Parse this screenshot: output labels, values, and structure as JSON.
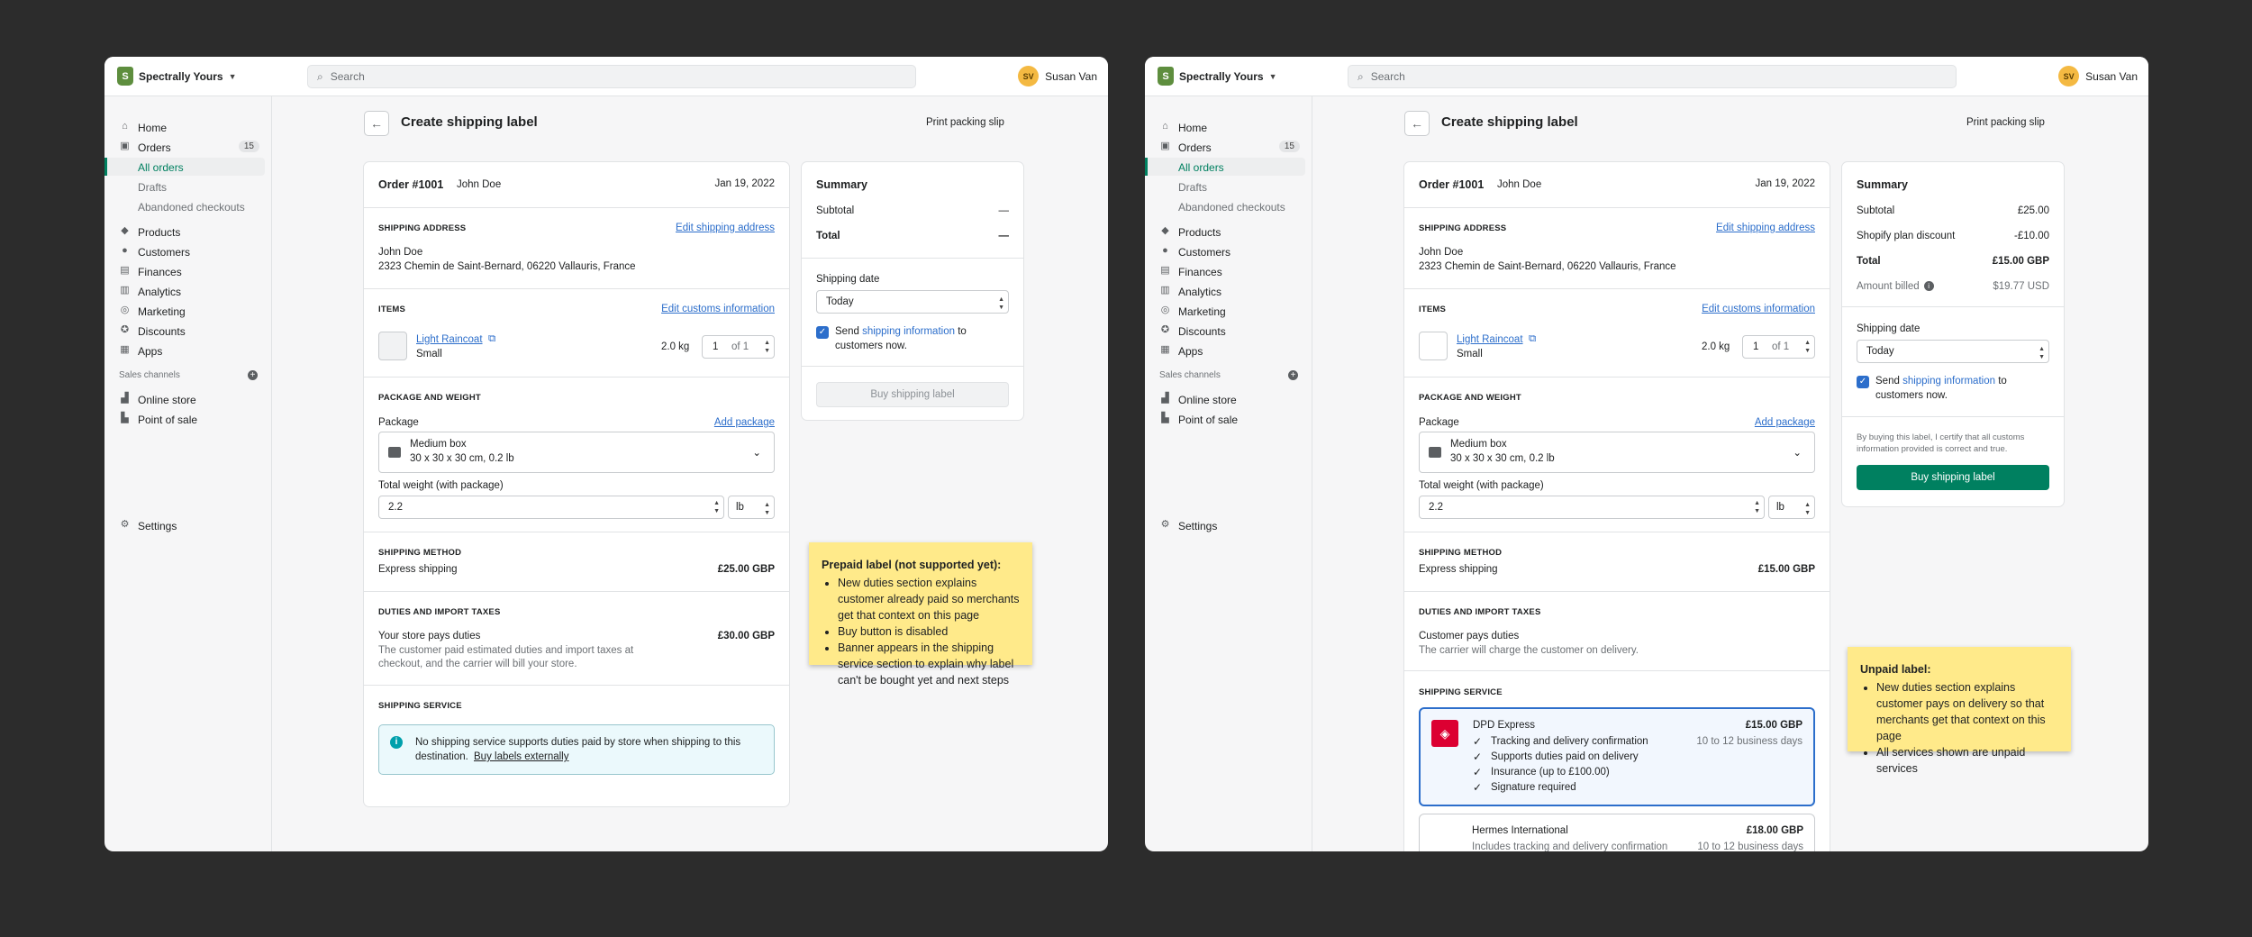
{
  "store_name": "Spectrally Yours",
  "search_placeholder": "Search",
  "user": {
    "initials": "SV",
    "name": "Susan Van"
  },
  "nav": {
    "home": "Home",
    "orders": "Orders",
    "orders_count": "15",
    "all_orders": "All orders",
    "drafts": "Drafts",
    "abandoned": "Abandoned checkouts",
    "products": "Products",
    "customers": "Customers",
    "finances": "Finances",
    "analytics": "Analytics",
    "marketing": "Marketing",
    "discounts": "Discounts",
    "apps": "Apps",
    "sales_channels": "Sales channels",
    "online_store": "Online store",
    "point_of_sale": "Point of sale",
    "settings": "Settings"
  },
  "page": {
    "title": "Create shipping label",
    "print_slip": "Print packing slip"
  },
  "order": {
    "number": "Order #1001",
    "customer": "John Doe",
    "date": "Jan 19, 2022",
    "shipping_address_heading": "SHIPPING ADDRESS",
    "edit_address": "Edit shipping address",
    "address_name": "John Doe",
    "address_line": "2323 Chemin de Saint-Bernard, 06220 Vallauris, France",
    "items_heading": "ITEMS",
    "edit_customs": "Edit customs information",
    "item_name": "Light Raincoat",
    "item_variant": "Small",
    "item_weight": "2.0 kg",
    "item_qty": "1",
    "item_of": "of 1",
    "package_heading": "PACKAGE AND WEIGHT",
    "package_label": "Package",
    "add_package": "Add package",
    "package_name": "Medium box",
    "package_dims": "30 x 30 x 30 cm, 0.2 lb",
    "total_weight_label": "Total weight (with package)",
    "total_weight": "2.2",
    "weight_unit": "lb",
    "method_heading": "SHIPPING METHOD",
    "method_name": "Express shipping",
    "duties_heading": "DUTIES AND IMPORT TAXES",
    "service_heading": "SHIPPING SERVICE"
  },
  "left": {
    "method_price": "£25.00 GBP",
    "duties_title": "Your store pays duties",
    "duties_price": "£30.00 GBP",
    "duties_desc_1": "The customer paid estimated duties and import taxes at",
    "duties_desc_2": "checkout, and the carrier will bill your store.",
    "banner_text_1": "No shipping service supports duties paid by store when shipping to this",
    "banner_text_2": "destination.",
    "banner_link": "Buy labels externally",
    "summary": {
      "title": "Summary",
      "subtotal": "Subtotal",
      "subtotal_value": "—",
      "total": "Total",
      "total_value": "—",
      "ship_date_label": "Shipping date",
      "ship_date": "Today",
      "send_pre": "Send",
      "send_link": "shipping information",
      "send_post": "to",
      "send_line2": "customers now.",
      "buy": "Buy shipping label"
    },
    "sticky": {
      "title": "Prepaid label (not supported yet):",
      "bullets": [
        "New duties section explains customer already paid so merchants get that context on this page",
        "Buy button is disabled",
        "Banner appears in the shipping service section to explain why label can't be bought yet and next steps"
      ]
    }
  },
  "right": {
    "method_price": "£15.00 GBP",
    "duties_title": "Customer pays duties",
    "duties_desc": "The carrier will charge the customer on delivery.",
    "services": [
      {
        "name": "DPD Express",
        "price": "£15.00 GBP",
        "eta": "10 to 12 business days",
        "features": [
          "Tracking and delivery confirmation",
          "Supports duties paid on delivery",
          "Insurance (up to £100.00)",
          "Signature required"
        ]
      },
      {
        "name": "Hermes International",
        "price": "£18.00 GBP",
        "eta": "10 to 12 business days",
        "desc": "Includes tracking and delivery confirmation"
      }
    ],
    "summary": {
      "title": "Summary",
      "subtotal": "Subtotal",
      "subtotal_value": "£25.00",
      "discount": "Shopify plan discount",
      "discount_value": "-£10.00",
      "total": "Total",
      "total_value": "£15.00 GBP",
      "amount_billed": "Amount billed",
      "amount_billed_value": "$19.77 USD",
      "ship_date_label": "Shipping date",
      "ship_date": "Today",
      "send_pre": "Send",
      "send_link": "shipping information",
      "send_post": "to",
      "send_line2": "customers now.",
      "certify_1": "By buying this label, I certify that all customs",
      "certify_2": "information provided is correct and true.",
      "buy": "Buy shipping label"
    },
    "sticky": {
      "title": "Unpaid label:",
      "bullets": [
        "New duties section explains customer pays on delivery so that merchants get that context on this page",
        "All services shown are unpaid services"
      ]
    }
  },
  "colors": {
    "background": "#2c2c2c",
    "brand": "#008060",
    "link": "#2c6ecb",
    "sticky": "#ffea8a",
    "dpd": "#dc0032"
  }
}
